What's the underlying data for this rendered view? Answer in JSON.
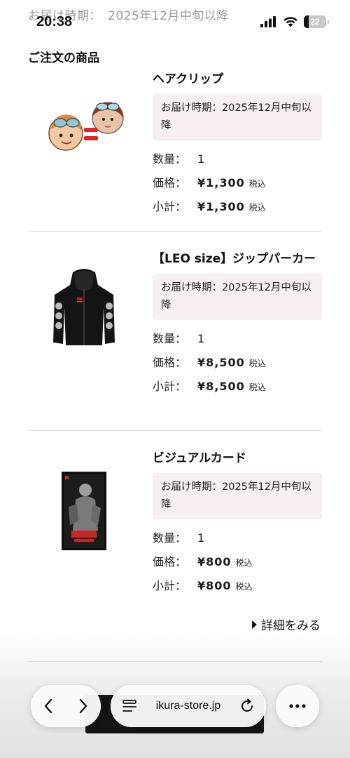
{
  "faded_header": "お届け時期：　2025年12月中旬以降",
  "status_bar": {
    "time": "20:38",
    "battery": "22",
    "battery_level": 0.22
  },
  "section_title": "ご注文の商品",
  "labels": {
    "quantity": "数量：",
    "price": "価格：",
    "subtotal": "小計：",
    "tax": "税込"
  },
  "items": [
    {
      "name": "ヘアクリップ",
      "delivery": "お届け時期：2025年12月中旬以降",
      "quantity": "1",
      "price": "¥1,300",
      "subtotal": "¥1,300",
      "image_icon": "hair-clip-product-image"
    },
    {
      "name": "【LEO size】ジップパーカー",
      "delivery": "お届け時期：2025年12月中旬以降",
      "quantity": "1",
      "price": "¥8,500",
      "subtotal": "¥8,500",
      "image_icon": "zip-hoodie-product-image"
    },
    {
      "name": "ビジュアルカード",
      "delivery": "お届け時期：2025年12月中旬以降",
      "quantity": "1",
      "price": "¥800",
      "subtotal": "¥800",
      "image_icon": "visual-card-product-image"
    }
  ],
  "more_link": "詳細をみる",
  "browser": {
    "url": "ikura-store.jp"
  }
}
